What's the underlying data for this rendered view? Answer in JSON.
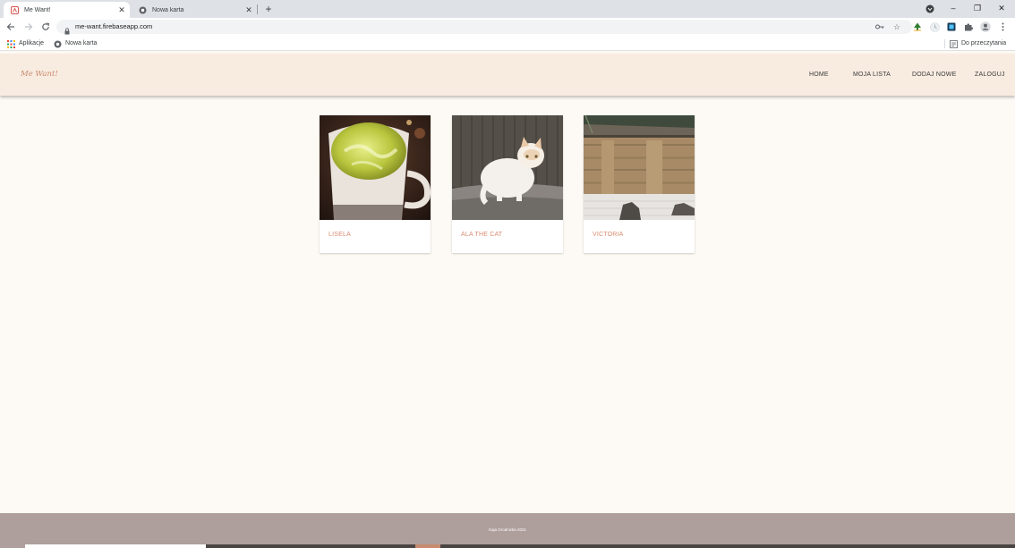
{
  "browser": {
    "tabs": [
      {
        "title": "Me Want!",
        "active": true
      },
      {
        "title": "Nowa karta",
        "active": false
      }
    ],
    "url": "me-want.firebaseapp.com",
    "bookmarks": {
      "apps": "Aplikacje",
      "new_tab": "Nowa karta",
      "reading_list": "Do przeczytania"
    },
    "window_controls": {
      "minimize": "–",
      "restore": "❐",
      "close": "✕"
    }
  },
  "site": {
    "logo": "Me Want!",
    "nav": [
      "HOME",
      "MOJA LISTA",
      "DODAJ NOWE",
      "ZALOGUJ"
    ],
    "cards": [
      {
        "caption": "LISELA",
        "image": "matcha-latte-photo"
      },
      {
        "caption": "ALA THE CAT",
        "image": "white-cat-photo"
      },
      {
        "caption": "VICTORIA",
        "image": "zen-garden-photo"
      }
    ],
    "footer": "Kaja Grodnicka 2021"
  },
  "colors": {
    "header_bg": "#f8ece1",
    "page_bg": "#fdf9f4",
    "accent": "#d98b6f",
    "footer_bg": "#ae9e9c"
  }
}
